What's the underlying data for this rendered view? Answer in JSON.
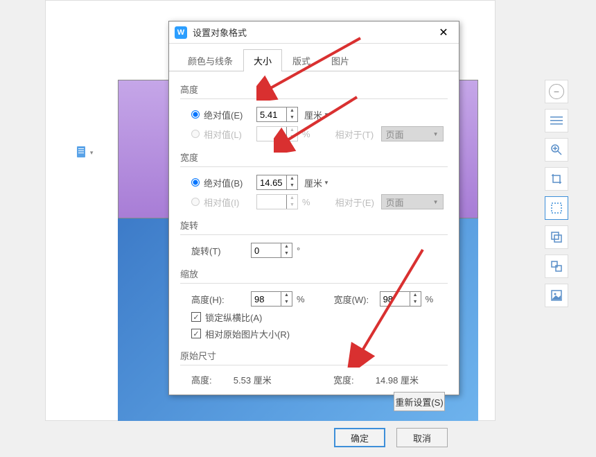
{
  "dialog": {
    "title": "设置对象格式",
    "tabs": {
      "color": "颜色与线条",
      "size": "大小",
      "layout": "版式",
      "picture": "图片"
    },
    "height": {
      "section_label": "高度",
      "abs_label": "绝对值(E)",
      "abs_value": "5.41",
      "abs_unit": "厘米",
      "rel_label": "相对值(L)",
      "rel_unit": "%",
      "relative_to_label": "相对于(T)",
      "relative_to_value": "页面"
    },
    "width": {
      "section_label": "宽度",
      "abs_label": "绝对值(B)",
      "abs_value": "14.65",
      "abs_unit": "厘米",
      "rel_label": "相对值(I)",
      "rel_unit": "%",
      "relative_to_label": "相对于(E)",
      "relative_to_value": "页面"
    },
    "rotation": {
      "section_label": "旋转",
      "label": "旋转(T)",
      "value": "0",
      "unit": "°"
    },
    "scale": {
      "section_label": "缩放",
      "height_label": "高度(H):",
      "height_value": "98",
      "height_unit": "%",
      "width_label": "宽度(W):",
      "width_value": "98",
      "width_unit": "%",
      "lock_aspect": "锁定纵横比(A)",
      "rel_original": "相对原始图片大小(R)"
    },
    "original": {
      "section_label": "原始尺寸",
      "height_label": "高度:",
      "height_value": "5.53 厘米",
      "width_label": "宽度:",
      "width_value": "14.98 厘米"
    },
    "reset_button": "重新设置(S)",
    "ok_button": "确定",
    "cancel_button": "取消"
  }
}
